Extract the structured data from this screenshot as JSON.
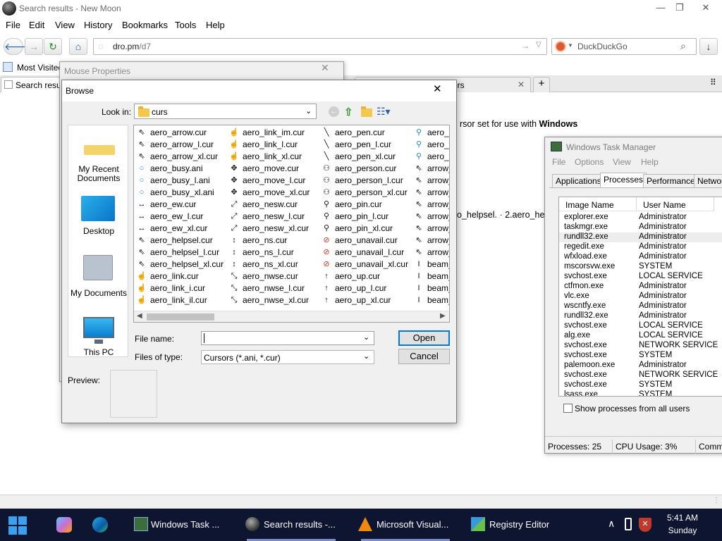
{
  "browser": {
    "window_title": "Search results - New Moon",
    "menu": [
      "File",
      "Edit",
      "View",
      "History",
      "Bookmarks",
      "Tools",
      "Help"
    ],
    "url_host": "dro.pm",
    "url_path": "/d7",
    "search_engine": "DuckDuckGo",
    "bookmarks_toolbar_item": "Most Visited",
    "tabs": [
      {
        "label": "Search resu",
        "active": true
      },
      {
        "label": "ors",
        "active": false
      }
    ],
    "page_snippets": {
      "line1_prefix": "rsor set for use with ",
      "line1_bold": "Windows",
      "line2": "o_helpsel. · 2.aero_he"
    }
  },
  "mouse_properties": {
    "title": "Mouse Properties"
  },
  "browse_dialog": {
    "title": "Browse",
    "look_in_label": "Look in:",
    "look_in_value": "curs",
    "places": [
      {
        "label": "My Recent Documents",
        "icon": "recent-documents-icon"
      },
      {
        "label": "Desktop",
        "icon": "desktop-icon"
      },
      {
        "label": "My Documents",
        "icon": "my-documents-icon"
      },
      {
        "label": "This PC",
        "icon": "this-pc-icon"
      }
    ],
    "files": [
      [
        "aero_arrow.cur",
        "aero_arrow_l.cur",
        "aero_arrow_xl.cur",
        "aero_busy.ani",
        "aero_busy_l.ani",
        "aero_busy_xl.ani",
        "aero_ew.cur",
        "aero_ew_l.cur",
        "aero_ew_xl.cur",
        "aero_helpsel.cur",
        "aero_helpsel_l.cur",
        "aero_helpsel_xl.cur",
        "aero_link.cur",
        "aero_link_i.cur",
        "aero_link_il.cur"
      ],
      [
        "aero_link_im.cur",
        "aero_link_l.cur",
        "aero_link_xl.cur",
        "aero_move.cur",
        "aero_move_l.cur",
        "aero_move_xl.cur",
        "aero_nesw.cur",
        "aero_nesw_l.cur",
        "aero_nesw_xl.cur",
        "aero_ns.cur",
        "aero_ns_l.cur",
        "aero_ns_xl.cur",
        "aero_nwse.cur",
        "aero_nwse_l.cur",
        "aero_nwse_xl.cur"
      ],
      [
        "aero_pen.cur",
        "aero_pen_l.cur",
        "aero_pen_xl.cur",
        "aero_person.cur",
        "aero_person_l.cur",
        "aero_person_xl.cur",
        "aero_pin.cur",
        "aero_pin_l.cur",
        "aero_pin_xl.cur",
        "aero_unavail.cur",
        "aero_unavail_l.cur",
        "aero_unavail_xl.cur",
        "aero_up.cur",
        "aero_up_l.cur",
        "aero_up_xl.cur"
      ],
      [
        "aero_w",
        "aero_w",
        "aero_w",
        "arrow_",
        "arrow_",
        "arrow_",
        "arrow_",
        "arrow_",
        "arrow_",
        "arrow_",
        "arrow_",
        "beam_",
        "beam_",
        "beam_",
        "beam_"
      ]
    ],
    "file_name_label": "File name:",
    "file_name_value": "",
    "files_of_type_label": "Files of type:",
    "files_of_type_value": "Cursors (*.ani, *.cur)",
    "open_label": "Open",
    "cancel_label": "Cancel",
    "preview_label": "Preview:"
  },
  "task_manager": {
    "title": "Windows Task Manager",
    "menu": [
      "File",
      "Options",
      "View",
      "Help"
    ],
    "tabs": [
      "Applications",
      "Processes",
      "Performance",
      "Networ"
    ],
    "active_tab": "Processes",
    "columns": [
      "Image Name",
      "User Name"
    ],
    "processes": [
      [
        "explorer.exe",
        "Administrator"
      ],
      [
        "taskmgr.exe",
        "Administrator"
      ],
      [
        "rundll32.exe",
        "Administrator"
      ],
      [
        "regedit.exe",
        "Administrator"
      ],
      [
        "wfxload.exe",
        "Administrator"
      ],
      [
        "mscorsvw.exe",
        "SYSTEM"
      ],
      [
        "svchost.exe",
        "LOCAL SERVICE"
      ],
      [
        "ctfmon.exe",
        "Administrator"
      ],
      [
        "vlc.exe",
        "Administrator"
      ],
      [
        "wscntfy.exe",
        "Administrator"
      ],
      [
        "rundll32.exe",
        "Administrator"
      ],
      [
        "svchost.exe",
        "LOCAL SERVICE"
      ],
      [
        "alg.exe",
        "LOCAL SERVICE"
      ],
      [
        "svchost.exe",
        "NETWORK SERVICE"
      ],
      [
        "svchost.exe",
        "SYSTEM"
      ],
      [
        "palemoon.exe",
        "Administrator"
      ],
      [
        "svchost.exe",
        "NETWORK SERVICE"
      ],
      [
        "svchost.exe",
        "SYSTEM"
      ],
      [
        "lsass.exe",
        "SYSTEM"
      ]
    ],
    "show_all_label": "Show processes from all users",
    "status_processes": "Processes: 25",
    "status_cpu": "CPU Usage: 3%",
    "status_commit": "Comm"
  },
  "taskbar": {
    "items": [
      {
        "label": "Windows Task ...",
        "icon": "task-manager-icon"
      },
      {
        "label": "Search results -...",
        "icon": "pale-moon-icon"
      },
      {
        "label": "Microsoft Visual...",
        "icon": "vlc-icon"
      },
      {
        "label": "Registry Editor",
        "icon": "registry-editor-icon"
      }
    ],
    "time": "5:41 AM",
    "day": "Sunday"
  },
  "colors": {
    "accent": "#0078d7",
    "taskbar": "#0d1530",
    "folder": "#f2c94c"
  }
}
